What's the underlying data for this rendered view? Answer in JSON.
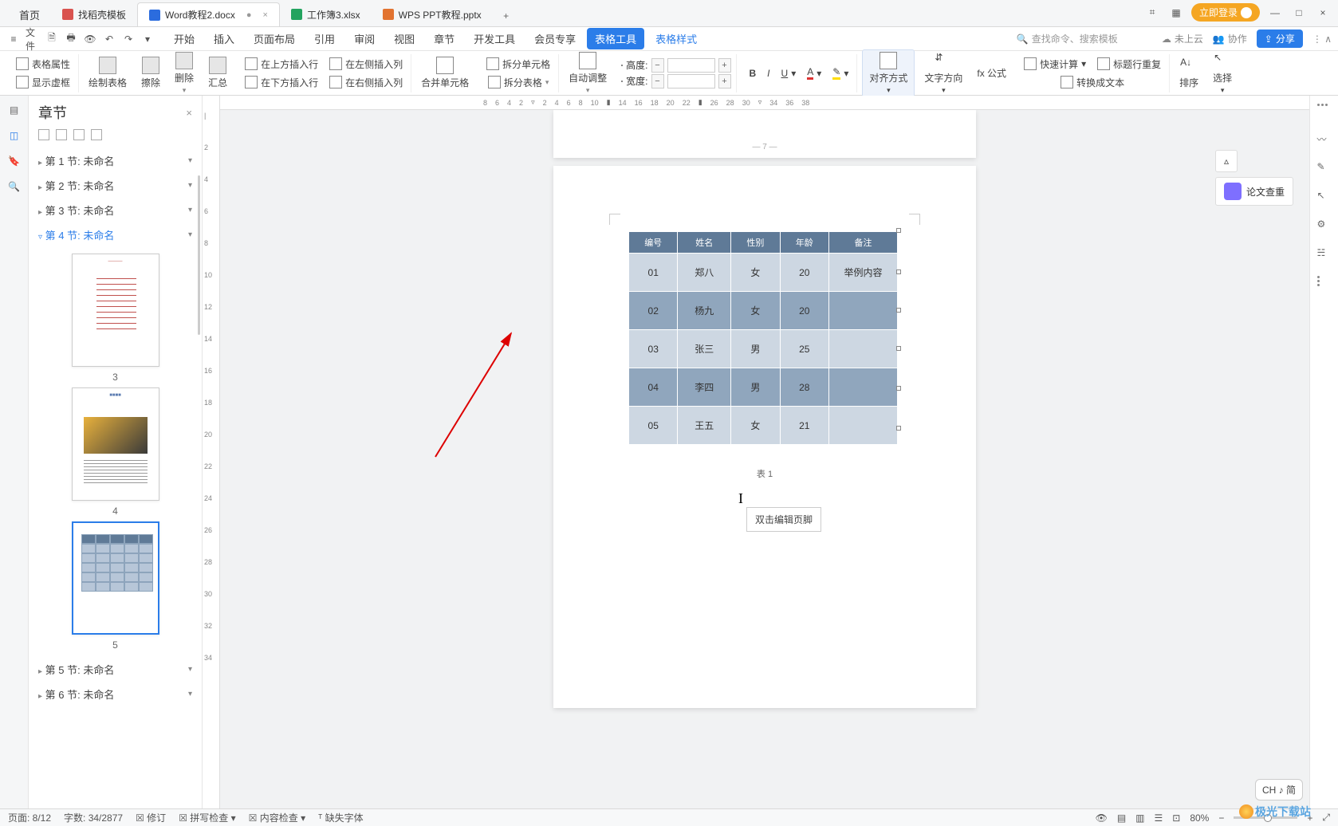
{
  "title_tabs": {
    "home": "首页",
    "items": [
      {
        "icon": "tpl",
        "label": "找稻壳模板"
      },
      {
        "icon": "word",
        "label": "Word教程2.docx",
        "active": true
      },
      {
        "icon": "sheet",
        "label": "工作簿3.xlsx"
      },
      {
        "icon": "ppt",
        "label": "WPS PPT教程.pptx"
      }
    ],
    "add": "+"
  },
  "title_right": {
    "login": "立即登录",
    "min": "—",
    "max": "□",
    "close": "×"
  },
  "menu": {
    "file_icons": [
      "≡",
      "文件",
      "📄",
      "🖨",
      "↩",
      "↪",
      "▾"
    ],
    "file_label": "文件",
    "tabs": [
      "开始",
      "插入",
      "页面布局",
      "引用",
      "审阅",
      "视图",
      "章节",
      "开发工具",
      "会员专享"
    ],
    "active_tool": "表格工具",
    "link": "表格样式",
    "search_placeholder": "查找命令、搜索模板",
    "cloud": "未上云",
    "collab": "协作",
    "share": "分享"
  },
  "ribbon": {
    "g1a": "表格属性",
    "g1b": "显示虚框",
    "g2": "绘制表格",
    "g3": "擦除",
    "g4": "删除",
    "g5": "汇总",
    "g6a": "在上方插入行",
    "g6b": "在下方插入行",
    "g6c": "在左侧插入列",
    "g6d": "在右侧插入列",
    "g7": "合并单元格",
    "g8a": "拆分单元格",
    "g8b": "拆分表格",
    "g9": "自动调整",
    "height": "高度:",
    "width": "宽度:",
    "align": "对齐方式",
    "textdir": "文字方向",
    "fx": "fx 公式",
    "calc": "快速计算",
    "titlerow": "标题行重复",
    "totext": "转换成文本",
    "sort": "排序",
    "select": "选择"
  },
  "sidebar": {
    "title": "章节",
    "sections": [
      {
        "label": "第 1 节: 未命名"
      },
      {
        "label": "第 2 节: 未命名"
      },
      {
        "label": "第 3 节: 未命名"
      },
      {
        "label": "第 4 节: 未命名",
        "sel": true
      },
      {
        "label": "第 5 节: 未命名"
      },
      {
        "label": "第 6 节: 未命名"
      }
    ],
    "thumb_nums": [
      "3",
      "4",
      "5"
    ]
  },
  "hruler_ticks": [
    "8",
    "6",
    "4",
    "2",
    "",
    "2",
    "4",
    "6",
    "8",
    "10",
    "",
    "14",
    "16",
    "18",
    "20",
    "22",
    "",
    "26",
    "28",
    "30",
    "",
    "34",
    "36",
    "38"
  ],
  "page_prev_num": "— 7 —",
  "chart_data": {
    "type": "table",
    "columns": [
      "编号",
      "姓名",
      "性别",
      "年龄",
      "备注"
    ],
    "rows": [
      [
        "01",
        "郑八",
        "女",
        "20",
        "举例内容"
      ],
      [
        "02",
        "杨九",
        "女",
        "20",
        ""
      ],
      [
        "03",
        "张三",
        "男",
        "25",
        ""
      ],
      [
        "04",
        "李四",
        "男",
        "28",
        ""
      ],
      [
        "05",
        "王五",
        "女",
        "21",
        ""
      ]
    ],
    "caption": "表 1"
  },
  "float_panel": {
    "collapse": "▵",
    "paper_check": "论文查重"
  },
  "tooltip": "双击编辑页脚",
  "ime": "CH ♪ 简",
  "status": {
    "page": "页面: 8/12",
    "words": "字数: 34/2877",
    "track": "修订",
    "spell": "拼写检查",
    "content": "内容检查",
    "missing": "缺失字体",
    "zoom": "80%"
  },
  "watermark": "极光下载站"
}
